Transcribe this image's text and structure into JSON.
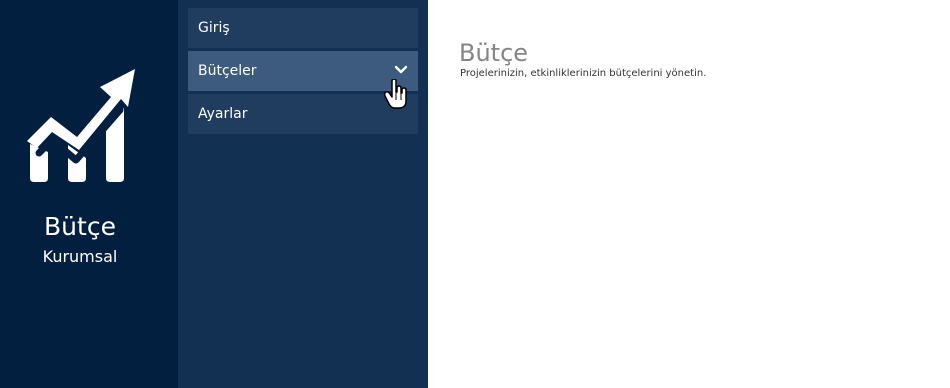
{
  "brand": {
    "title": "Bütçe",
    "subtitle": "Kurumsal",
    "logo_icon": "chart-growth-icon"
  },
  "navigation": {
    "items": [
      {
        "label": "Giriş",
        "active": false
      },
      {
        "label": "Bütçeler",
        "active": true,
        "icon": "chevron-down-icon"
      },
      {
        "label": "Ayarlar",
        "active": false
      }
    ]
  },
  "page": {
    "title": "Bütçe",
    "description": "Projelerinizin, etkinliklerinizin bütçelerini yönetin."
  },
  "cursor": {
    "icon": "pointer-hand-icon"
  },
  "colors": {
    "brand_background": "#021f3f",
    "nav_background": "#123052",
    "nav_item": "#203d5f",
    "nav_item_active": "#3d5b7e",
    "content_background": "#ffffff",
    "page_title": "#858585"
  }
}
